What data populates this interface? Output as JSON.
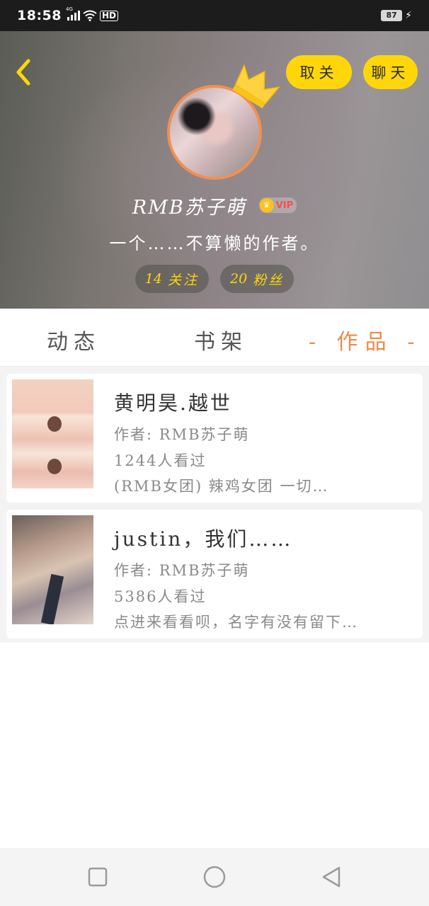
{
  "status_bar": {
    "time": "18:58",
    "network": "4G",
    "hd": "HD",
    "battery": "87"
  },
  "header": {
    "unfollow_label": "取关",
    "chat_label": "聊天",
    "username": "RMB苏子萌",
    "vip_badge": "VIP",
    "bio": "一个……不算懒的作者。",
    "following_count": "14",
    "following_label": "关注",
    "followers_count": "20",
    "followers_label": "粉丝"
  },
  "tabs": [
    {
      "label": "动态",
      "active": false
    },
    {
      "label": "书架",
      "active": false
    },
    {
      "label": "- 作品 -",
      "active": true
    }
  ],
  "works": [
    {
      "title": "黄明昊.越世",
      "author": "作者: RMB苏子萌",
      "views": "1244人看过",
      "description": "(RMB女团) 辣鸡女团 一切…"
    },
    {
      "title": "justin，我们……",
      "author": "作者: RMB苏子萌",
      "views": "5386人看过",
      "description": "点进来看看呗，名字有没有留下…"
    }
  ],
  "colors": {
    "accent_yellow": "#ffd60a",
    "active_tab": "#f08a44",
    "avatar_border": "#f2904f"
  },
  "icons": {
    "back": "chevron-left-icon",
    "crown": "crown-icon",
    "nav_recent": "square-icon",
    "nav_home": "circle-icon",
    "nav_back": "triangle-back-icon"
  }
}
